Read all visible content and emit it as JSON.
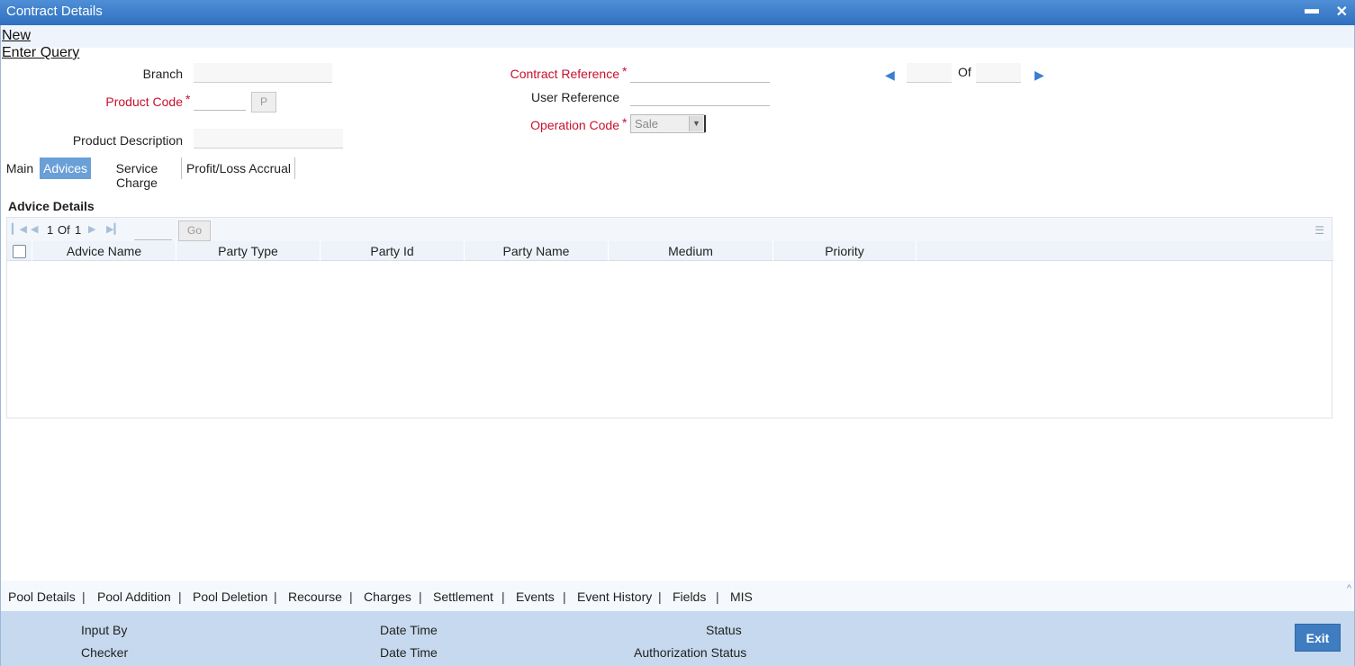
{
  "window": {
    "title": "Contract Details",
    "minimize": "▬",
    "close": "✕"
  },
  "menu": {
    "new": "New",
    "enter_query": "Enter Query"
  },
  "form": {
    "branch_label": "Branch",
    "product_code_label": "Product Code",
    "product_desc_label": "Product Description",
    "contract_ref_label": "Contract Reference",
    "user_ref_label": "User Reference",
    "operation_code_label": "Operation Code",
    "operation_code_value": "Sale",
    "required_mark": "*",
    "p_button": "P",
    "of_label": "Of",
    "prev_icon": "prev-arrow",
    "next_icon": "next-arrow"
  },
  "tabs": [
    {
      "label": "Main",
      "active": false
    },
    {
      "label": "Advices",
      "active": true
    },
    {
      "label": "Service Charge",
      "active": false
    },
    {
      "label": "Profit/Loss Accrual",
      "active": false
    }
  ],
  "advice_details": {
    "title": "Advice Details",
    "pager": {
      "page": "1",
      "of": "Of",
      "total": "1",
      "go": "Go"
    },
    "columns": [
      "Advice Name",
      "Party Type",
      "Party Id",
      "Party Name",
      "Medium",
      "Priority"
    ],
    "rows": []
  },
  "footer_links": [
    "Pool Details",
    "Pool Addition",
    "Pool Deletion",
    "Recourse",
    "Charges",
    "Settlement",
    "Events",
    "Event History",
    "Fields",
    "MIS"
  ],
  "footer_sep": "|",
  "status": {
    "input_by": "Input By",
    "checker": "Checker",
    "date_time_1": "Date Time",
    "date_time_2": "Date Time",
    "status": "Status",
    "auth_status": "Authorization Status",
    "exit": "Exit"
  },
  "colors": {
    "titlebar": "#2f6fc0",
    "active_tab": "#6a9fd8",
    "required": "#c8102e",
    "status_bar": "#c6d9ee",
    "exit_button": "#3f7cc0"
  }
}
